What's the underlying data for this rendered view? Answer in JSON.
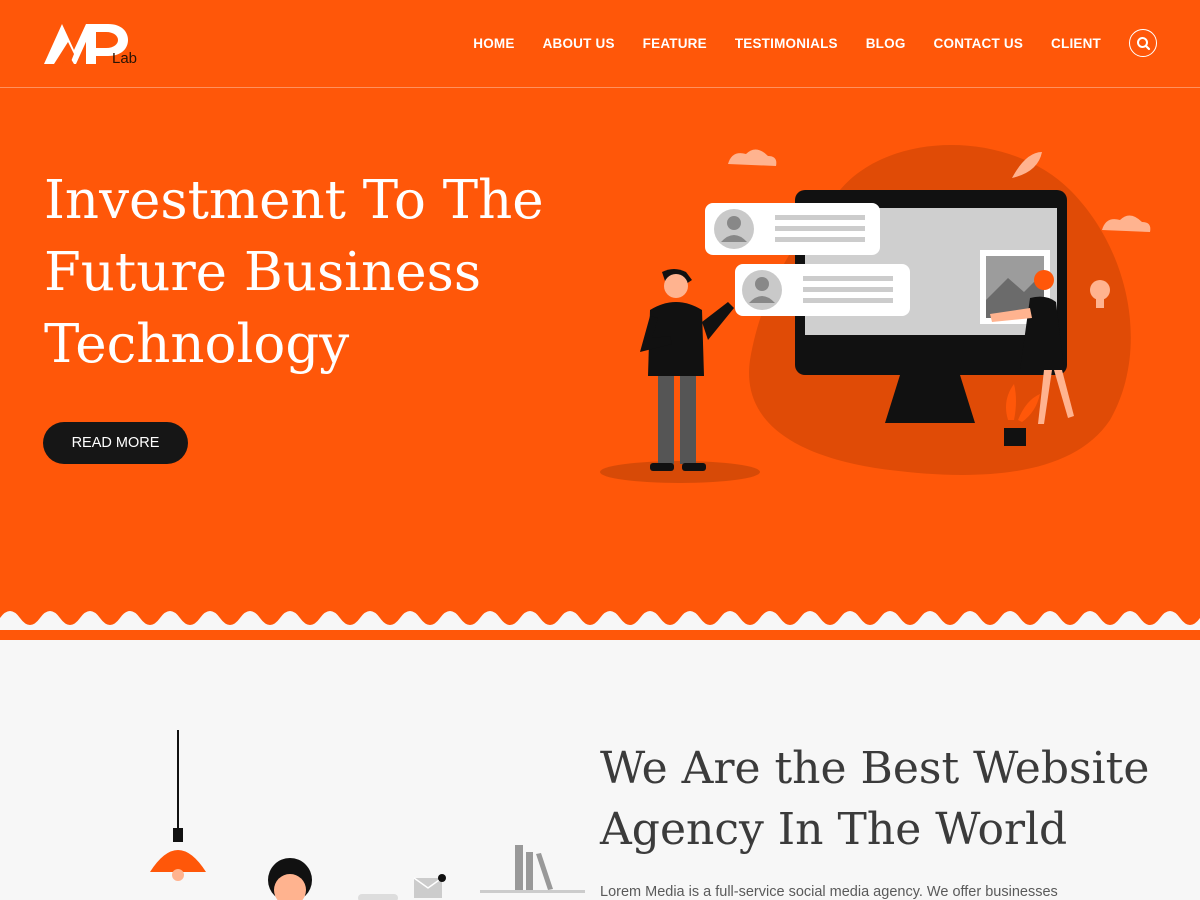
{
  "brand": {
    "logo_text": "AP",
    "logo_sub": "Lab"
  },
  "nav": {
    "items": [
      {
        "label": "HOME"
      },
      {
        "label": "ABOUT US"
      },
      {
        "label": "FEATURE"
      },
      {
        "label": "TESTIMONIALS"
      },
      {
        "label": "BLOG"
      },
      {
        "label": "CONTACT US"
      },
      {
        "label": "CLIENT"
      }
    ],
    "search_icon": "search-icon"
  },
  "hero": {
    "title": "Investment To The Future Business Technology",
    "button_label": "READ MORE",
    "illustration": "business-presentation-illustration"
  },
  "about": {
    "title": "We Are the Best Website Agency In The World",
    "text": "Lorem Media is a full-service social media agency. We offer businesses"
  },
  "colors": {
    "accent": "#ff5709",
    "dark": "#161616",
    "light_bg": "#f7f7f7"
  }
}
